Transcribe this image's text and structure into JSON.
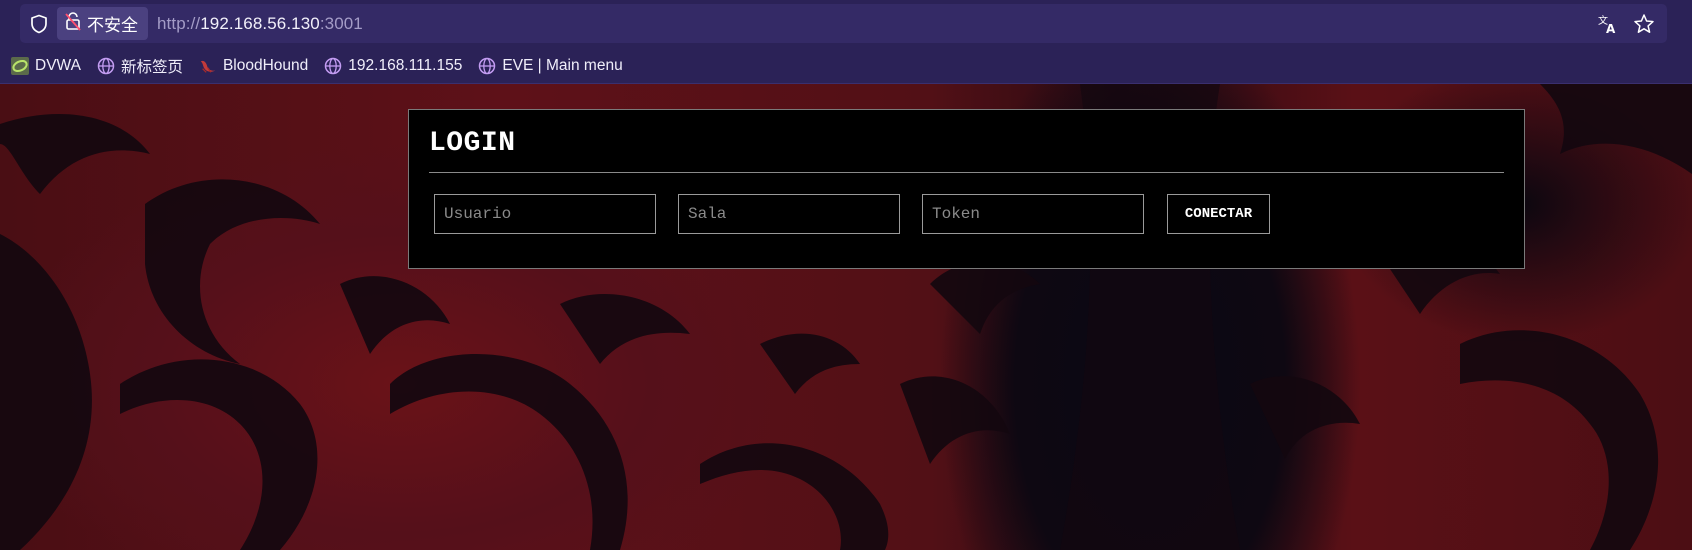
{
  "browser": {
    "security_label": "不安全",
    "url": {
      "scheme": "http://",
      "host": "192.168.56.130",
      "port": ":3001"
    },
    "icons": {
      "shield": "shield-icon",
      "insecure_lock": "insecure-lock-icon",
      "translate": "translate-icon",
      "bookmark_star": "star-icon"
    },
    "bookmarks": [
      {
        "label": "DVWA",
        "icon": "dvwa-icon"
      },
      {
        "label": "新标签页",
        "icon": "globe-icon"
      },
      {
        "label": "BloodHound",
        "icon": "bloodhound-icon"
      },
      {
        "label": "192.168.111.155",
        "icon": "globe-icon"
      },
      {
        "label": "EVE | Main menu",
        "icon": "globe-icon"
      }
    ],
    "colors": {
      "chrome_bg": "#2b2257",
      "address_bar_bg": "#342a66",
      "security_chip_bg": "#4b4180",
      "globe_icon": "#c39cf2"
    }
  },
  "login": {
    "title": "LOGIN",
    "fields": {
      "user_placeholder": "Usuario",
      "room_placeholder": "Sala",
      "token_placeholder": "Token"
    },
    "connect_label": "CONECTAR",
    "colors": {
      "panel_bg": "#000000",
      "text": "#ffffff",
      "border": "#9a9a9a"
    }
  },
  "background": {
    "description_colors": [
      "#5e1118",
      "#0e0812"
    ]
  }
}
